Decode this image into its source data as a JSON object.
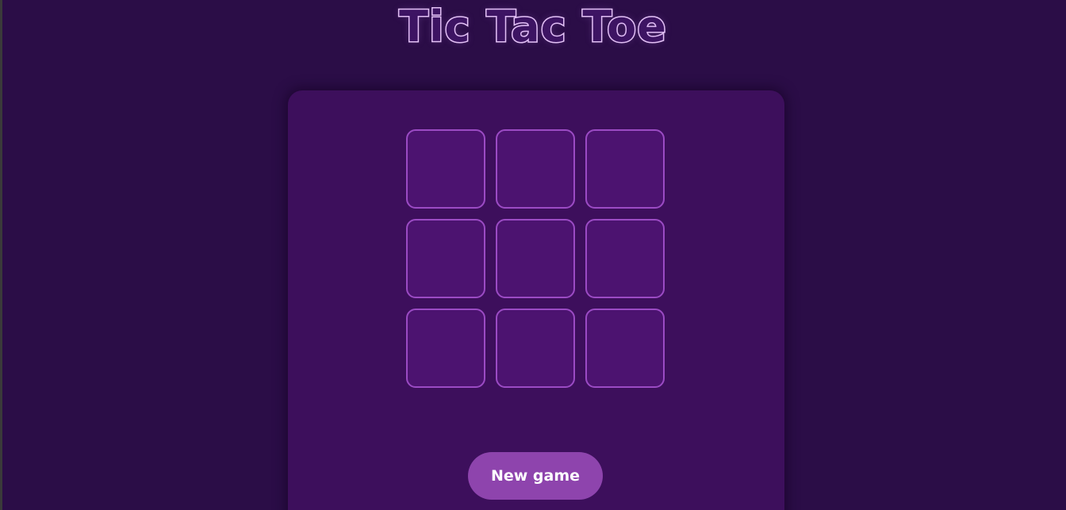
{
  "game": {
    "title": "Tic Tac Toe",
    "board": [
      "",
      "",
      "",
      "",
      "",
      "",
      "",
      "",
      ""
    ],
    "new_game_label": "New game"
  },
  "colors": {
    "background": "#2b0d47",
    "card": "#3d0f5c",
    "cell_fill": "#4c1370",
    "cell_border": "#9b4bc4",
    "button": "#8e44ad",
    "title_outline": "#e8c8f8"
  }
}
